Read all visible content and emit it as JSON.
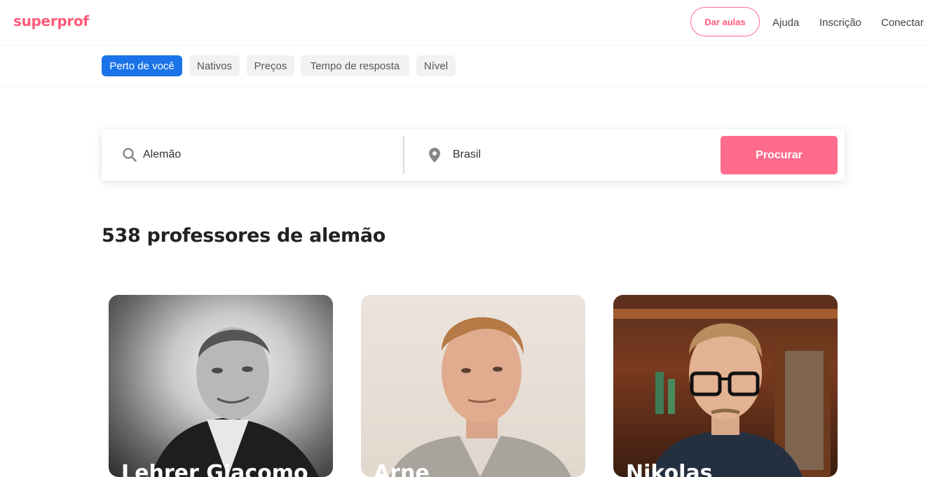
{
  "header": {
    "logo": "superprof",
    "give_lessons": "Dar aulas",
    "help": "Ajuda",
    "signup": "Inscrição",
    "login": "Conectar"
  },
  "filters": [
    "Perto de você",
    "Nativos",
    "Preços",
    "Tempo de resposta",
    "Nível"
  ],
  "search": {
    "subject_value": "Alemão",
    "location_value": "Brasil",
    "button_label": "Procurar"
  },
  "results": {
    "heading": "538 professores de alemão"
  },
  "cards": [
    {
      "name": "Lehrer Giacomo"
    },
    {
      "name": "Arne"
    },
    {
      "name": "Nikolas"
    }
  ],
  "colors": {
    "brand": "#ff5a7a",
    "active_filter": "#1a73e8",
    "search_button": "#ff6b8b"
  },
  "icons": {
    "subject": "search-icon",
    "location": "location-pin-icon"
  }
}
